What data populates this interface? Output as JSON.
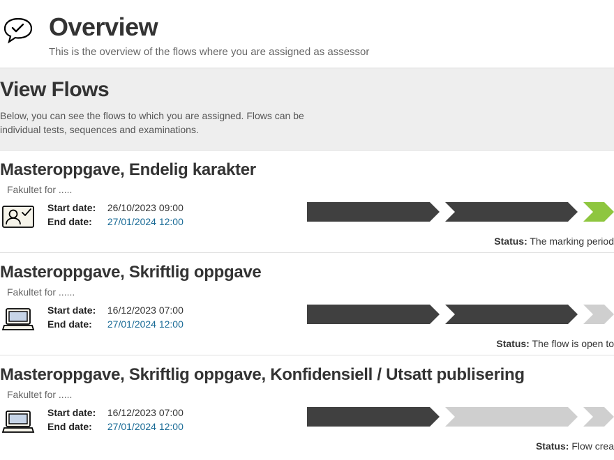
{
  "header": {
    "title": "Overview",
    "subtitle": "This is the overview of the flows where you are assigned as assessor"
  },
  "section": {
    "title": "View Flows",
    "description": "Below, you can see the flows to which you are assigned. Flows can be individual tests, sequences and examinations."
  },
  "labels": {
    "start_date": "Start date:",
    "end_date": "End date:",
    "status": "Status:"
  },
  "colors": {
    "chev_dark": "#404040",
    "chev_light": "#cfcfcf",
    "chev_green": "#8ec63f"
  },
  "flows": [
    {
      "title": "Masteroppgave, Endelig karakter",
      "faculty": "Fakultet for .....",
      "start": "26/10/2023 09:00",
      "end": "27/01/2024 12:00",
      "status_text": "The marking period",
      "chevrons": [
        "dark",
        "dark",
        "green_small"
      ],
      "icon": "person-check"
    },
    {
      "title": "Masteroppgave, Skriftlig oppgave",
      "faculty": "Fakultet for ......",
      "start": "16/12/2023 07:00",
      "end": "27/01/2024 12:00",
      "status_text": "The flow is open to",
      "chevrons": [
        "dark",
        "dark",
        "light_small"
      ],
      "icon": "laptop"
    },
    {
      "title": "Masteroppgave, Skriftlig oppgave, Konfidensiell / Utsatt publisering",
      "faculty": "Fakultet for .....",
      "start": "16/12/2023 07:00",
      "end": "27/01/2024 12:00",
      "status_text": "Flow crea",
      "chevrons": [
        "dark",
        "light",
        "light_small"
      ],
      "icon": "laptop"
    }
  ]
}
